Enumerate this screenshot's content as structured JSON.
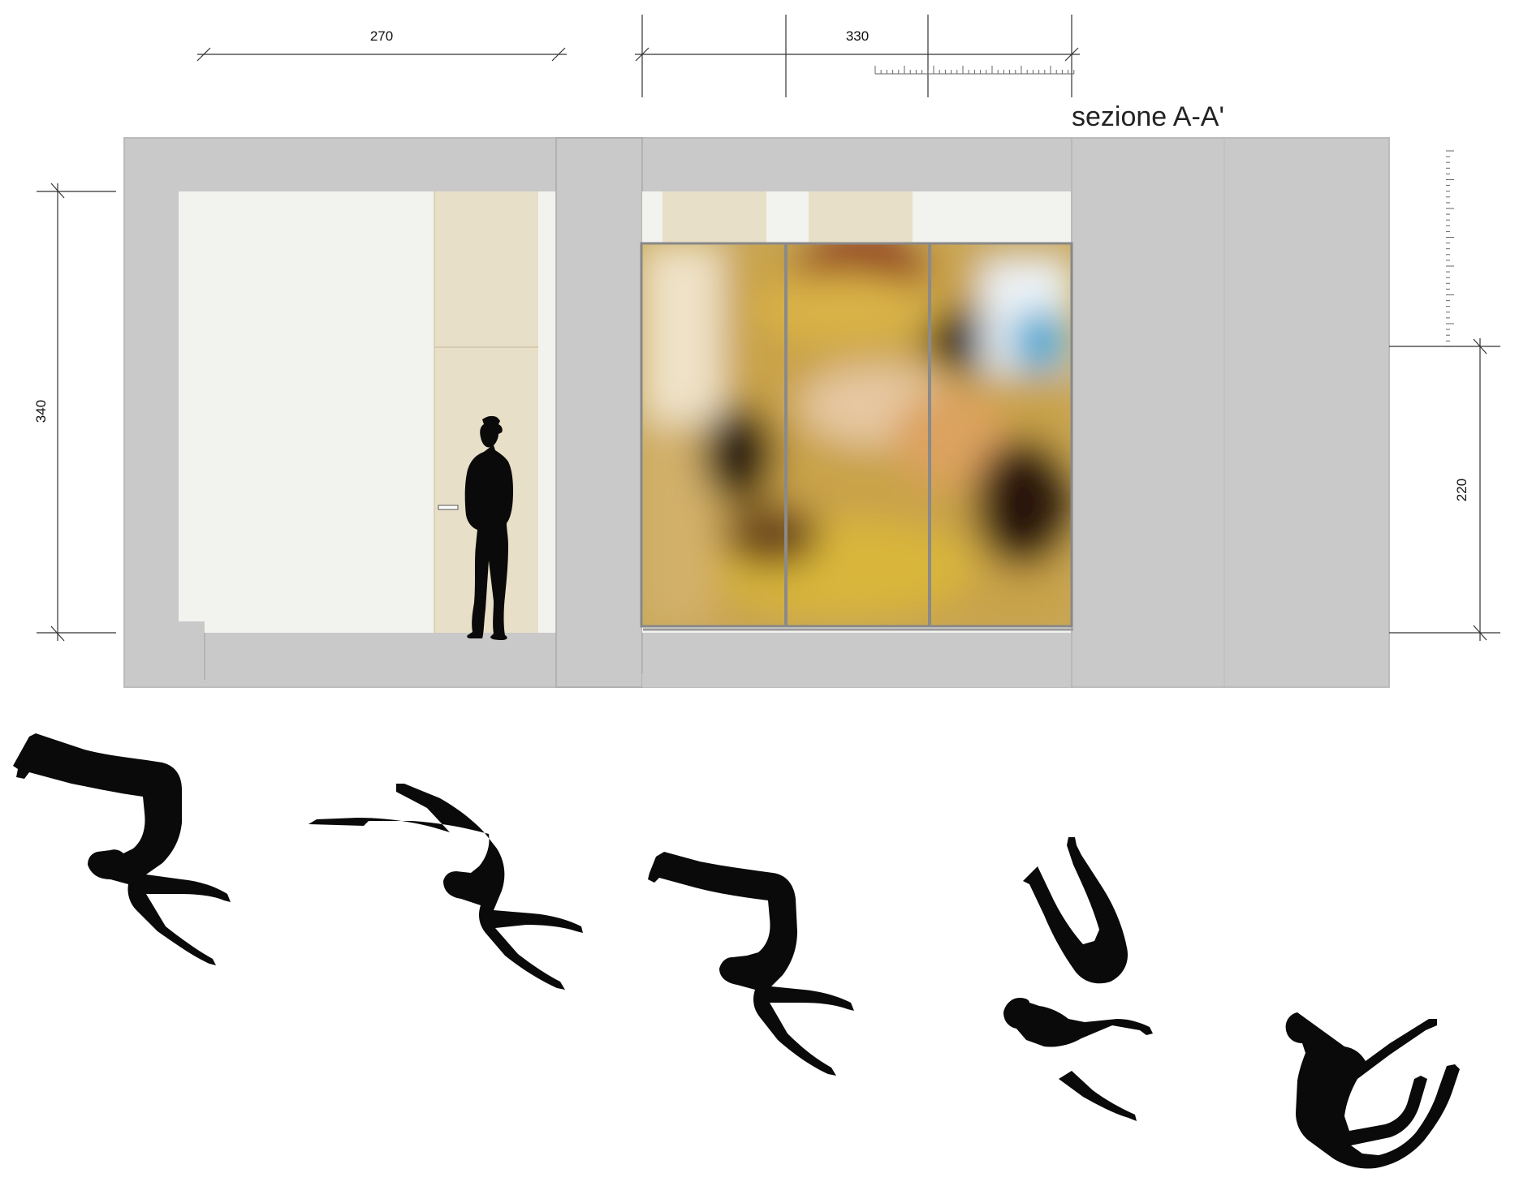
{
  "title": "sezione A-A'",
  "dimensions": {
    "top_left": "270",
    "top_right": "330",
    "left_height": "340",
    "right_height": "220"
  },
  "colors": {
    "wall": "#c9c9c9",
    "room": "#f2f2ee",
    "panel": "#e8dfc8",
    "silhouette": "#0a0a0a",
    "dimension_line": "#333333"
  },
  "figures": {
    "standing_person": "person-silhouette-icon",
    "gymnast_sequence": [
      "gymnast-pose-1-icon",
      "gymnast-pose-2-icon",
      "gymnast-pose-3-icon",
      "gymnast-pose-4-icon",
      "gymnast-pose-5-icon"
    ]
  }
}
